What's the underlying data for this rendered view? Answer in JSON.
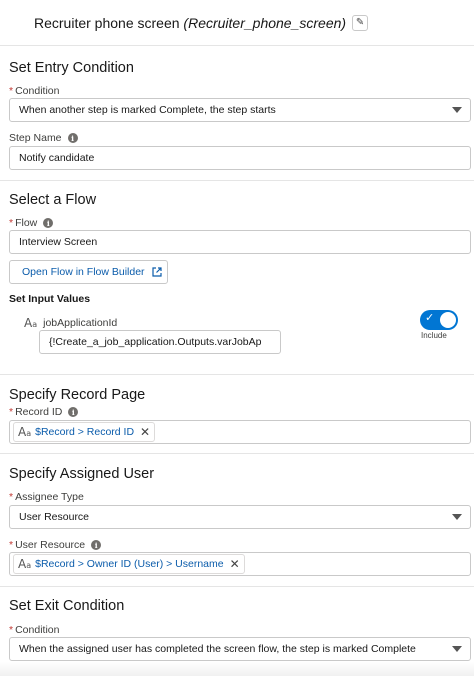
{
  "header": {
    "title": "Recruiter phone screen",
    "api_name": "(Recruiter_phone_screen)",
    "edit_icon": "pencil-icon"
  },
  "entry_condition": {
    "title": "Set Entry Condition",
    "condition_label": "Condition",
    "condition_value": "When another step is marked Complete, the step starts",
    "step_name_label": "Step Name",
    "step_name_value": "Notify candidate"
  },
  "flow": {
    "title": "Select a Flow",
    "flow_label": "Flow",
    "flow_value": "Interview Screen",
    "open_button": "Open Flow in Flow Builder",
    "input_values_title": "Set Input Values",
    "input_name": "jobApplicationId",
    "input_value": "{!Create_a_job_application.Outputs.varJobAp",
    "include_label": "Include",
    "include_checked": true
  },
  "record_page": {
    "title": "Specify Record Page",
    "record_id_label": "Record ID",
    "record_id_value": "$Record > Record ID"
  },
  "assigned_user": {
    "title": "Specify Assigned User",
    "assignee_type_label": "Assignee Type",
    "assignee_type_value": "User Resource",
    "user_resource_label": "User Resource",
    "user_resource_value": "$Record > Owner ID (User) > Username"
  },
  "exit_condition": {
    "title": "Set Exit Condition",
    "condition_label": "Condition",
    "condition_value": "When the assigned user has completed the screen flow, the step is marked Complete"
  },
  "colors": {
    "link": "#0b5cab",
    "toggle": "#0176d3",
    "required": "#c23934"
  }
}
